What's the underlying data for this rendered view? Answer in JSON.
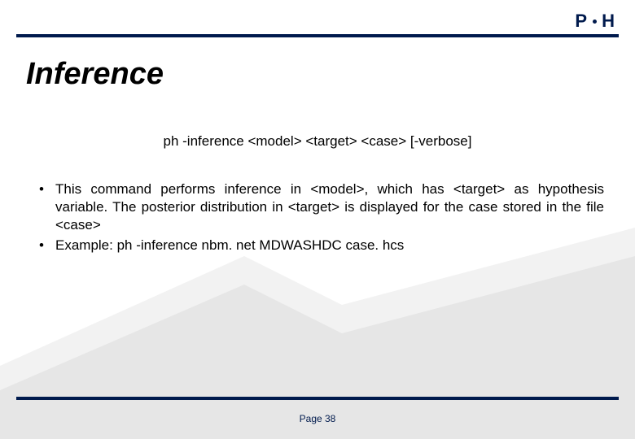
{
  "logo": {
    "p": "P",
    "h": "H"
  },
  "title": "Inference",
  "syntax": "ph -inference <model> <target> <case> [-verbose]",
  "bullets": [
    "This command performs inference in <model>, which has <target> as hypothesis variable. The posterior distribution in <target> is displayed for the case stored in the file <case>",
    "Example: ph -inference nbm. net MDWASHDC case. hcs"
  ],
  "page_label": "Page 38"
}
